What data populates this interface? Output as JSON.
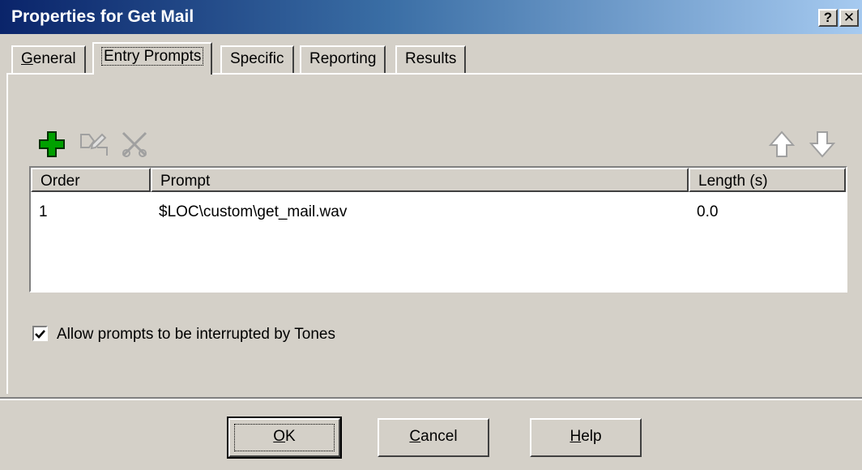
{
  "window": {
    "title": "Properties for Get Mail",
    "help_glyph": "?",
    "close_glyph": "✕"
  },
  "tabs": [
    {
      "label": "General",
      "mnemonic": "G",
      "rest": "eneral"
    },
    {
      "label": "Entry Prompts"
    },
    {
      "label": "Specific"
    },
    {
      "label": "Reporting"
    },
    {
      "label": "Results"
    }
  ],
  "active_tab": "Entry Prompts",
  "toolbar": {
    "icons": [
      "add-icon",
      "edit-icon",
      "delete-icon",
      "move-up-icon",
      "move-down-icon"
    ]
  },
  "prompts_table": {
    "columns": [
      "Order",
      "Prompt",
      "Length (s)"
    ],
    "rows": [
      {
        "order": "1",
        "prompt": "$LOC\\custom\\get_mail.wav",
        "length": "0.0"
      }
    ]
  },
  "checkbox": {
    "label": "Allow prompts to be interrupted by Tones",
    "checked": true
  },
  "buttons": {
    "ok": {
      "label": "OK",
      "mnemonic": "O",
      "rest": "K"
    },
    "cancel": {
      "label": "Cancel",
      "mnemonic": "C",
      "rest": "ancel"
    },
    "help": {
      "label": "Help",
      "mnemonic": "H",
      "rest": "elp"
    }
  },
  "colors": {
    "title_start": "#0a246a",
    "title_end": "#a6caf0",
    "face": "#d4d0c8",
    "add_icon": "#00a000"
  }
}
